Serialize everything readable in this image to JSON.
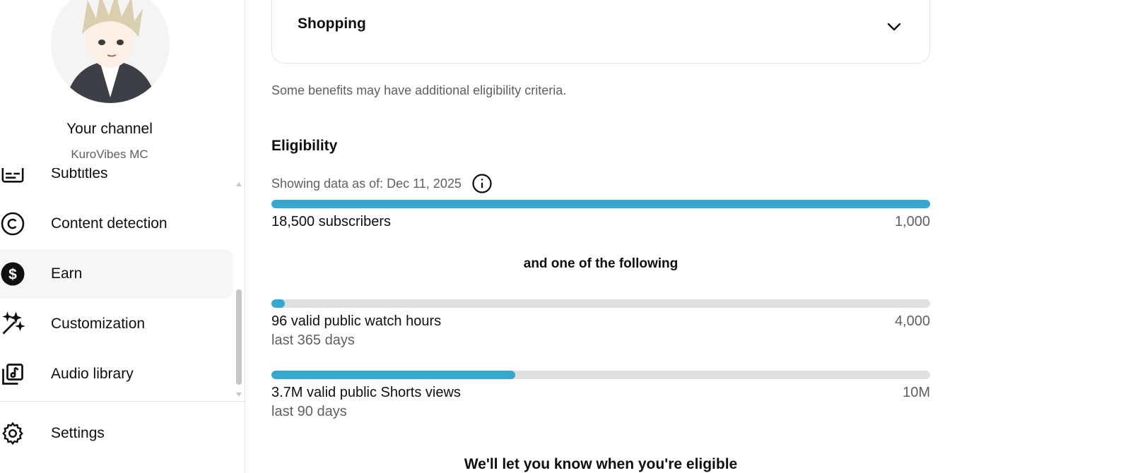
{
  "sidebar": {
    "channel_title": "Your channel",
    "channel_handle": "KuroVibes MC",
    "items": [
      {
        "label": "Subtitles",
        "icon": "subtitles-icon"
      },
      {
        "label": "Content detection",
        "icon": "copyright-icon"
      },
      {
        "label": "Earn",
        "icon": "dollar-circle-icon",
        "active": true
      },
      {
        "label": "Customization",
        "icon": "magic-wand-icon"
      },
      {
        "label": "Audio library",
        "icon": "audio-library-icon"
      }
    ],
    "settings_label": "Settings"
  },
  "main": {
    "accordion_title": "Shopping",
    "note": "Some benefits may have additional eligibility criteria.",
    "eligibility_title": "Eligibility",
    "data_as_of": "Showing data as of: Dec 11, 2025",
    "and_text": "and one of the following",
    "notify_text": "We'll let you know when you're eligible",
    "metrics": [
      {
        "label": "18,500 subscribers",
        "target": "1,000",
        "sub": "",
        "progress": 1.0
      },
      {
        "label": "96 valid public watch hours",
        "target": "4,000",
        "sub": "last 365 days",
        "progress": 0.02
      },
      {
        "label": "3.7M valid public Shorts views",
        "target": "10M",
        "sub": "last 90 days",
        "progress": 0.37
      }
    ]
  },
  "colors": {
    "progress_fill": "#34a8cf",
    "progress_track": "#e0e0e0",
    "active_nav_bg": "#f7f7f7"
  }
}
